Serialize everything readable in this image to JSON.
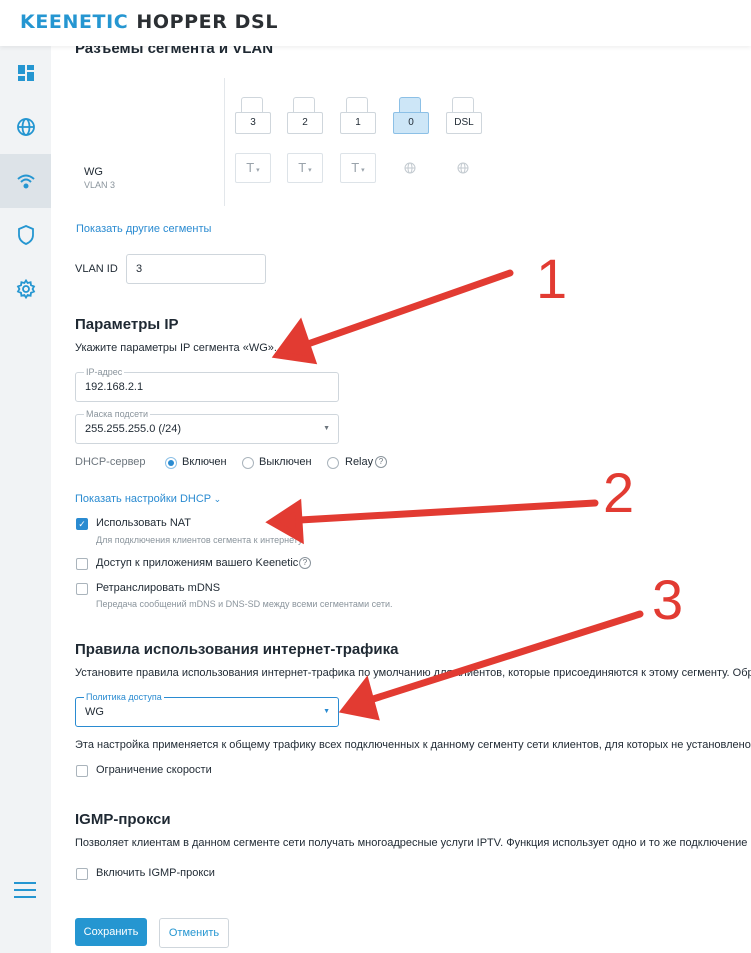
{
  "header": {
    "brand_keenetic": "KEENETIC",
    "brand_model": "HOPPER DSL"
  },
  "sidebar": {
    "items": [
      {
        "name": "dashboard-icon"
      },
      {
        "name": "globe-icon"
      },
      {
        "name": "wifi-icon"
      },
      {
        "name": "shield-icon"
      },
      {
        "name": "gear-icon"
      }
    ],
    "active_index": 2
  },
  "segment": {
    "title": "Разъемы сегмента и VLAN",
    "name": "WG",
    "vlan_caption": "VLAN 3",
    "ports": [
      "3",
      "2",
      "1",
      "0",
      "DSL"
    ],
    "selected_port": "0",
    "tag_symbol": "T",
    "show_other_link": "Показать другие сегменты",
    "vlan_id_label": "VLAN ID",
    "vlan_id_value": "3"
  },
  "ip": {
    "title": "Параметры IP",
    "description": "Укажите параметры IP сегмента «WG».",
    "address_label": "IP-адрес",
    "address_value": "192.168.2.1",
    "mask_label": "Маска подсети",
    "mask_value": "255.255.255.0 (/24)",
    "dhcp_label": "DHCP-сервер",
    "dhcp_options": [
      "Включен",
      "Выключен",
      "Relay"
    ],
    "dhcp_selected": "Включен",
    "dhcp_settings_link": "Показать настройки DHCP",
    "nat_label": "Использовать NAT",
    "nat_hint": "Для подключения клиентов сегмента к интернету.",
    "nat_checked": true,
    "apps_label": "Доступ к приложениям вашего Keenetic",
    "mdns_label": "Ретранслировать mDNS",
    "mdns_hint": "Передача сообщений mDNS и DNS-SD между всеми сегментами сети."
  },
  "traffic": {
    "title": "Правила использования интернет-трафика",
    "description": "Установите правила использования интернет-трафика по умолчанию для клиентов, которые присоединяются к этому сегменту. Обрати",
    "policy_label": "Политика доступа",
    "policy_value": "WG",
    "note": "Эта настройка применяется к общему трафику всех подключенных к данному сегменту сети клиентов, для которых не установлено инд",
    "speed_limit_label": "Ограничение скорости"
  },
  "igmp": {
    "title": "IGMP-прокси",
    "description": "Позволяет клиентам в данном сегменте сети получать многоадресные услуги IPTV. Функция использует одно и то же подключение к пр",
    "enable_label": "Включить IGMP-прокси"
  },
  "footer": {
    "save_label": "Сохранить",
    "cancel_label": "Отменить"
  },
  "annotations": {
    "numbers": [
      "1",
      "2",
      "3"
    ],
    "color": "#e23b32"
  }
}
